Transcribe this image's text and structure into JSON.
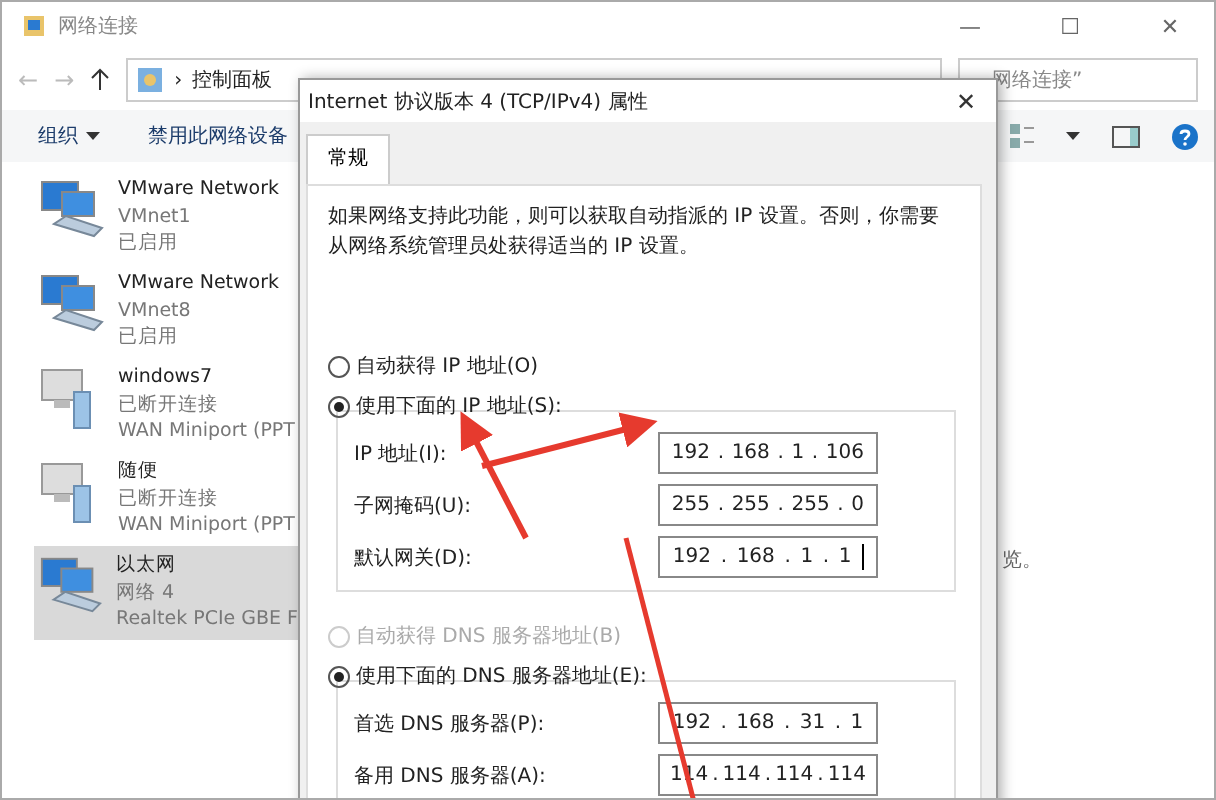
{
  "window": {
    "title": "网络连接",
    "controls": [
      "—",
      "☐",
      "✕"
    ]
  },
  "nav": {
    "back": "←",
    "forward": "→",
    "breadcrumb": "控制面板",
    "separator": "›",
    "search_placeholder": "网络连接”"
  },
  "toolbar": {
    "items": [
      {
        "label": "组织",
        "dropdown": true
      },
      {
        "label": "禁用此网络设备",
        "dropdown": false
      }
    ]
  },
  "connections": [
    {
      "name": "VMware Network",
      "line2": "VMnet1",
      "line3": "已启用",
      "selected": false,
      "kind": "adapter"
    },
    {
      "name": "VMware Network",
      "line2": "VMnet8",
      "line3": "已启用",
      "selected": false,
      "kind": "adapter"
    },
    {
      "name": "windows7",
      "line2": "已断开连接",
      "line3": "WAN Miniport (PPT",
      "selected": false,
      "kind": "wan"
    },
    {
      "name": "随便",
      "line2": "已断开连接",
      "line3": "WAN Miniport (PPT",
      "selected": false,
      "kind": "wan"
    },
    {
      "name": "以太网",
      "line2": "网络 4",
      "line3": "Realtek PCIe GBE F",
      "selected": true,
      "kind": "adapter"
    }
  ],
  "preview_hint": "览。",
  "dialog": {
    "title": "Internet 协议版本 4 (TCP/IPv4) 属性",
    "close": "✕",
    "tabs": [
      {
        "label": "常规",
        "selected": true
      }
    ],
    "ip_separator": ".",
    "description": "如果网络支持此功能，则可以获取自动指派的 IP 设置。否则，你需要从网络系统管理员处获得适当的 IP 设置。",
    "ip_mode": [
      {
        "label": "自动获得 IP 地址(O)",
        "selected": false,
        "disabled": false
      },
      {
        "label": "使用下面的 IP 地址(S):",
        "selected": true,
        "disabled": false
      }
    ],
    "ip_fields": [
      {
        "label": "IP 地址(I):",
        "value": [
          "192",
          "168",
          "1",
          "106"
        ]
      },
      {
        "label": "子网掩码(U):",
        "value": [
          "255",
          "255",
          "255",
          "0"
        ]
      },
      {
        "label": "默认网关(D):",
        "value": [
          "192",
          "168",
          "1",
          "1"
        ],
        "focused": true
      }
    ],
    "dns_mode": [
      {
        "label": "自动获得 DNS 服务器地址(B)",
        "selected": false,
        "disabled": true
      },
      {
        "label": "使用下面的 DNS 服务器地址(E):",
        "selected": true,
        "disabled": false
      }
    ],
    "dns_fields": [
      {
        "label": "首选 DNS 服务器(P):",
        "value": [
          "192",
          "168",
          "31",
          "1"
        ]
      },
      {
        "label": "备用 DNS 服务器(A):",
        "value": [
          "114",
          "114",
          "114",
          "114"
        ]
      }
    ]
  }
}
